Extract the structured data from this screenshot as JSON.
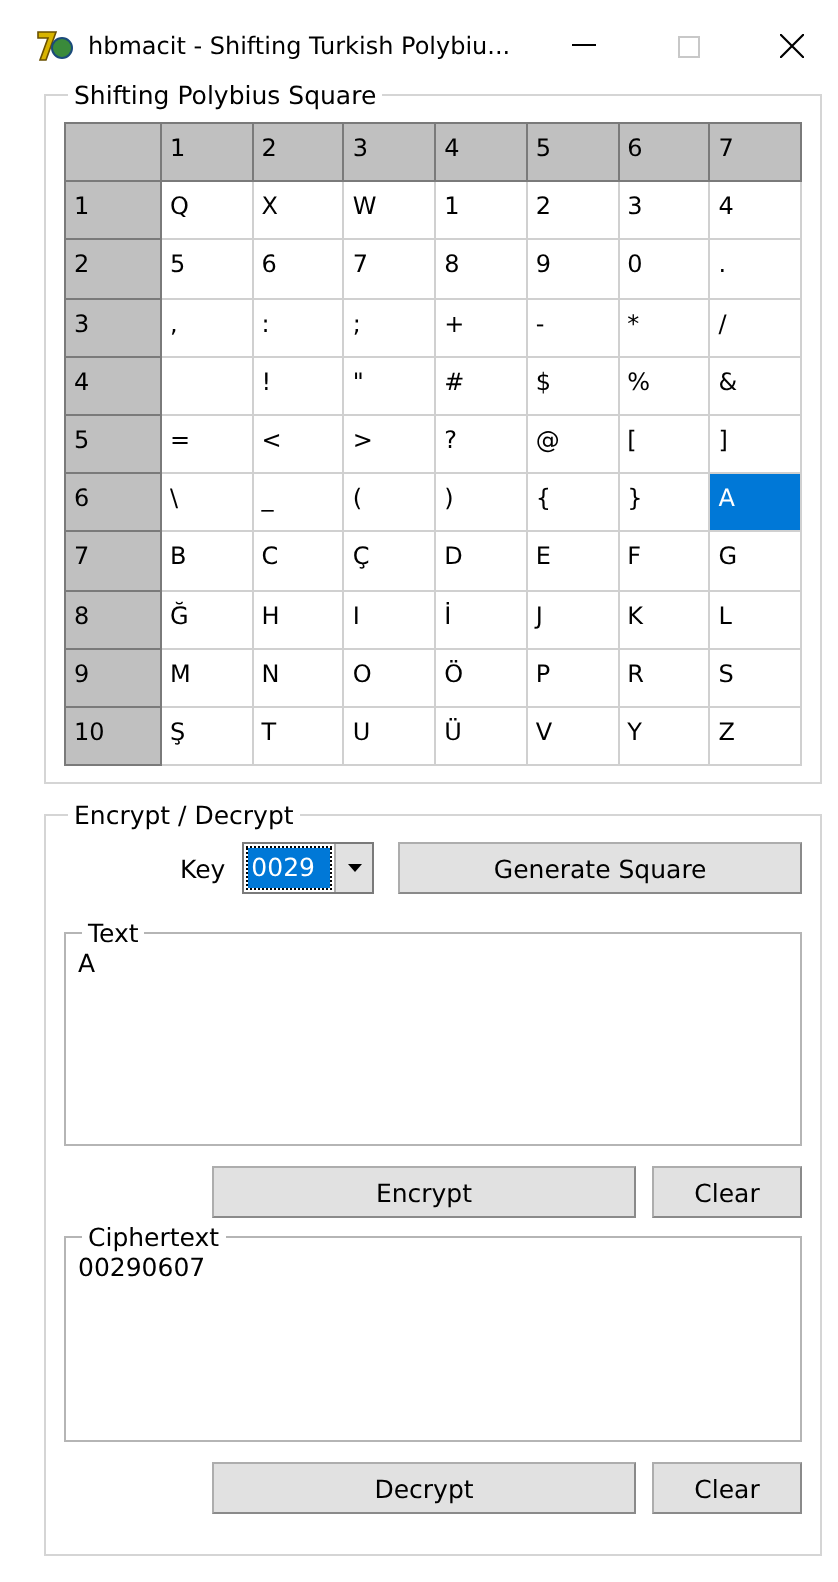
{
  "window": {
    "title": "hbmacit - Shifting Turkish Polybiu...",
    "maximize_disabled": true
  },
  "square": {
    "title": "Shifting Polybius Square",
    "columns": [
      "1",
      "2",
      "3",
      "4",
      "5",
      "6",
      "7"
    ],
    "rows": [
      {
        "header": "1",
        "cells": [
          {
            "text": "Q",
            "selected": false
          },
          {
            "text": "X",
            "selected": false
          },
          {
            "text": "W",
            "selected": false
          },
          {
            "text": "1",
            "selected": false
          },
          {
            "text": "2",
            "selected": false
          },
          {
            "text": "3",
            "selected": false
          },
          {
            "text": "4",
            "selected": false
          }
        ]
      },
      {
        "header": "2",
        "cells": [
          {
            "text": "5",
            "selected": false
          },
          {
            "text": "6",
            "selected": false
          },
          {
            "text": "7",
            "selected": false
          },
          {
            "text": "8",
            "selected": false
          },
          {
            "text": "9",
            "selected": false
          },
          {
            "text": "0",
            "selected": false
          },
          {
            "text": ".",
            "selected": false
          }
        ]
      },
      {
        "header": "3",
        "cells": [
          {
            "text": ",",
            "selected": false
          },
          {
            "text": ":",
            "selected": false
          },
          {
            "text": ";",
            "selected": false
          },
          {
            "text": "+",
            "selected": false
          },
          {
            "text": "-",
            "selected": false
          },
          {
            "text": "*",
            "selected": false
          },
          {
            "text": "/",
            "selected": false
          }
        ]
      },
      {
        "header": "4",
        "cells": [
          {
            "selected": false
          },
          {
            "text": "!",
            "selected": false
          },
          {
            "text": "\"",
            "selected": false
          },
          {
            "text": "#",
            "selected": false
          },
          {
            "text": "$",
            "selected": false
          },
          {
            "text": "%",
            "selected": false
          },
          {
            "text": "&",
            "selected": false
          }
        ]
      },
      {
        "header": "5",
        "cells": [
          {
            "text": "=",
            "selected": false
          },
          {
            "text": "<",
            "selected": false
          },
          {
            "text": ">",
            "selected": false
          },
          {
            "text": "?",
            "selected": false
          },
          {
            "text": "@",
            "selected": false
          },
          {
            "text": "[",
            "selected": false
          },
          {
            "text": "]",
            "selected": false
          }
        ]
      },
      {
        "header": "6",
        "cells": [
          {
            "text": "\\",
            "selected": false
          },
          {
            "text": "_",
            "selected": false
          },
          {
            "text": "(",
            "selected": false
          },
          {
            "text": ")",
            "selected": false
          },
          {
            "text": "{",
            "selected": false
          },
          {
            "text": "}",
            "selected": false
          },
          {
            "text": "A",
            "selected": true
          }
        ]
      },
      {
        "header": "7",
        "cells": [
          {
            "text": "B",
            "selected": false
          },
          {
            "text": "C",
            "selected": false
          },
          {
            "text": "Ç",
            "selected": false
          },
          {
            "text": "D",
            "selected": false
          },
          {
            "text": "E",
            "selected": false
          },
          {
            "text": "F",
            "selected": false
          },
          {
            "text": "G",
            "selected": false
          }
        ]
      },
      {
        "header": "8",
        "cells": [
          {
            "text": "Ğ",
            "selected": false
          },
          {
            "text": "H",
            "selected": false
          },
          {
            "text": "I",
            "selected": false
          },
          {
            "text": "İ",
            "selected": false
          },
          {
            "text": "J",
            "selected": false
          },
          {
            "text": "K",
            "selected": false
          },
          {
            "text": "L",
            "selected": false
          }
        ]
      },
      {
        "header": "9",
        "cells": [
          {
            "text": "M",
            "selected": false
          },
          {
            "text": "N",
            "selected": false
          },
          {
            "text": "O",
            "selected": false
          },
          {
            "text": "Ö",
            "selected": false
          },
          {
            "text": "P",
            "selected": false
          },
          {
            "text": "R",
            "selected": false
          },
          {
            "text": "S",
            "selected": false
          }
        ]
      },
      {
        "header": "10",
        "cells": [
          {
            "text": "Ş",
            "selected": false
          },
          {
            "text": "T",
            "selected": false
          },
          {
            "text": "U",
            "selected": false
          },
          {
            "text": "Ü",
            "selected": false
          },
          {
            "text": "V",
            "selected": false
          },
          {
            "text": "Y",
            "selected": false
          },
          {
            "text": "Z",
            "selected": false
          }
        ]
      }
    ]
  },
  "crypt": {
    "title": "Encrypt / Decrypt",
    "key_label": "Key",
    "key_value": "0029",
    "generate_button": "Generate Square",
    "text_box": {
      "title": "Text",
      "value": "A"
    },
    "encrypt_button": "Encrypt",
    "clear_text_button": "Clear",
    "cipher_box": {
      "title": "Ciphertext",
      "value": "00290607"
    },
    "decrypt_button": "Decrypt",
    "clear_cipher_button": "Clear"
  }
}
